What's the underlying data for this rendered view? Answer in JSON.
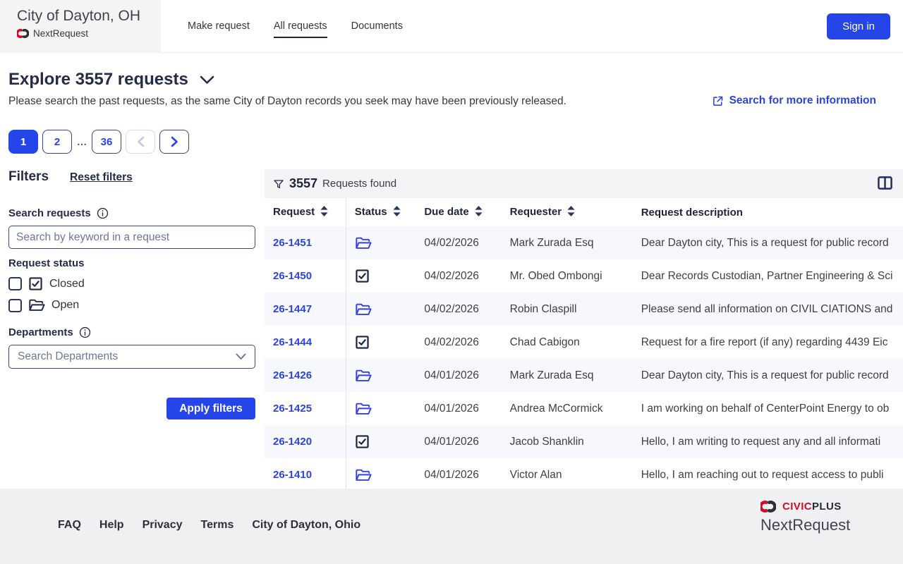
{
  "colors": {
    "accent_blue": "#2545e8",
    "link_blue": "#2b44e0",
    "dark_navy": "#262b49",
    "open_icon_blue": "#3340e8",
    "closed_icon_navy": "#1c2240",
    "brand_red": "#c8102e",
    "bar_gray": "#f4f4f6",
    "footer_gray": "#eff0f1"
  },
  "header": {
    "org_name": "City of Dayton, OH",
    "brand": "NextRequest",
    "nav": [
      {
        "label": "Make request",
        "active": false
      },
      {
        "label": "All requests",
        "active": true
      },
      {
        "label": "Documents",
        "active": false
      }
    ],
    "sign_in_label": "Sign in"
  },
  "page": {
    "title": "Explore 3557 requests",
    "subtitle": "Please search the past requests, as the same City of Dayton records you seek may have been previously released.",
    "search_more_label": "Search for more information"
  },
  "pagination": {
    "items": [
      {
        "label": "1",
        "state": "active"
      },
      {
        "label": "2",
        "state": "normal"
      },
      {
        "label": "…",
        "state": "ellipsis"
      },
      {
        "label": "36",
        "state": "normal"
      }
    ],
    "prev_enabled": false,
    "next_enabled": true
  },
  "filters": {
    "title": "Filters",
    "reset_label": "Reset filters",
    "search_label": "Search requests",
    "search_placeholder": "Search by keyword in a request",
    "search_value": "",
    "status_label": "Request status",
    "status_options": [
      {
        "label": "Closed",
        "icon": "check-square",
        "checked": false
      },
      {
        "label": "Open",
        "icon": "folder-open",
        "checked": false
      }
    ],
    "departments_label": "Departments",
    "departments_placeholder": "Search Departments",
    "apply_label": "Apply filters"
  },
  "table": {
    "count": "3557",
    "count_suffix": "Requests found",
    "columns": [
      {
        "label": "Request",
        "sortable": true
      },
      {
        "label": "Status",
        "sortable": true
      },
      {
        "label": "Due date",
        "sortable": true
      },
      {
        "label": "Requester",
        "sortable": true
      },
      {
        "label": "Request description",
        "sortable": false
      }
    ],
    "rows": [
      {
        "id": "26-1451",
        "status": "open",
        "due_date": "04/02/2026",
        "requester": "Mark Zurada Esq",
        "description": "Dear Dayton city, This is a request for public record"
      },
      {
        "id": "26-1450",
        "status": "closed",
        "due_date": "04/02/2026",
        "requester": "Mr. Obed Ombongi",
        "description": "Dear Records Custodian, Partner Engineering & Sci"
      },
      {
        "id": "26-1447",
        "status": "open",
        "due_date": "04/02/2026",
        "requester": "Robin Claspill",
        "description": "Please send all information on CIVIL CIATIONS and"
      },
      {
        "id": "26-1444",
        "status": "closed",
        "due_date": "04/02/2026",
        "requester": "Chad Cabigon",
        "description": "Request for a fire report (if any) regarding 4439 Eic"
      },
      {
        "id": "26-1426",
        "status": "open",
        "due_date": "04/01/2026",
        "requester": "Mark Zurada Esq",
        "description": "Dear Dayton city, This is a request for public record"
      },
      {
        "id": "26-1425",
        "status": "open",
        "due_date": "04/01/2026",
        "requester": "Andrea McCormick",
        "description": "I am working on behalf of CenterPoint Energy to ob"
      },
      {
        "id": "26-1420",
        "status": "closed",
        "due_date": "04/01/2026",
        "requester": "Jacob Shanklin",
        "description": "Hello,  I am writing to request any and all informati"
      },
      {
        "id": "26-1410",
        "status": "open",
        "due_date": "04/01/2026",
        "requester": "Victor Alan",
        "description": "Hello, I am reaching out to request access to publi"
      }
    ]
  },
  "footer": {
    "links": [
      "FAQ",
      "Help",
      "Privacy",
      "Terms",
      "City of Dayton, Ohio"
    ],
    "brand_word_red": "CIVIC",
    "brand_word_dark": "PLUS",
    "brand_product": "NextRequest"
  }
}
